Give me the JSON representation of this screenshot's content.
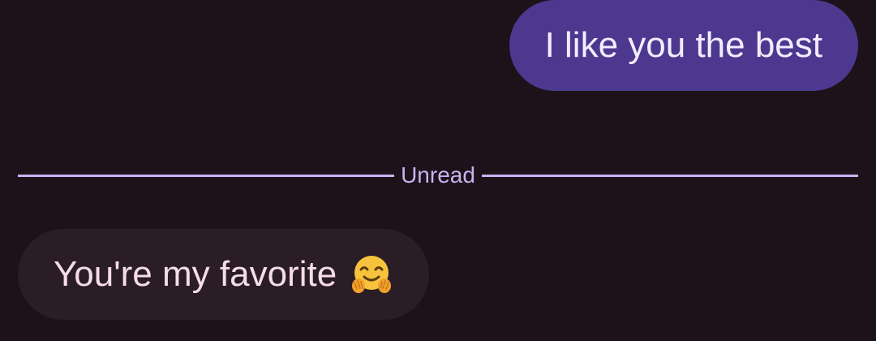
{
  "messages": [
    {
      "direction": "outgoing",
      "text": "I like you the best"
    },
    {
      "direction": "incoming",
      "text": "You're my favorite",
      "emoji": "hugging-face-emoji"
    }
  ],
  "divider": {
    "label": "Unread"
  },
  "colors": {
    "background": "#1d1219",
    "outgoing_bubble": "#4c398f",
    "incoming_bubble": "#2a1d25",
    "divider_accent": "#c9b2f2"
  }
}
